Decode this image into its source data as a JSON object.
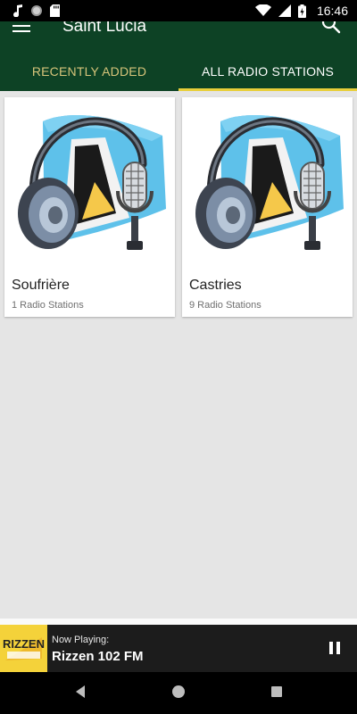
{
  "status_bar": {
    "time": "16:46",
    "left_icons": [
      "music-note-icon",
      "record-icon",
      "sd-card-icon"
    ],
    "right_icons": [
      "wifi-icon",
      "signal-icon",
      "battery-icon"
    ]
  },
  "app_bar": {
    "title": "Saint Lucia",
    "menu_icon": "hamburger-icon",
    "search_icon": "search-icon",
    "background_color": "#0d4225"
  },
  "tabs": [
    {
      "label": "RECENTLY ADDED",
      "active": false,
      "color": "#d6c47a"
    },
    {
      "label": "ALL RADIO STATIONS",
      "active": true,
      "color": "#ffffff"
    }
  ],
  "tab_indicator_color": "#e8cf3a",
  "cards": [
    {
      "title": "Soufrière",
      "subtitle": "1 Radio Stations",
      "image": "headphones-microphone-flag-icon"
    },
    {
      "title": "Castries",
      "subtitle": "9 Radio Stations",
      "image": "headphones-microphone-flag-icon"
    }
  ],
  "now_playing": {
    "label": "Now Playing:",
    "station": "Rizzen 102 FM",
    "logo_text": "RIZZEN",
    "pause_icon": "pause-icon"
  },
  "nav_bar": {
    "icons": [
      "back-icon",
      "home-icon",
      "recents-icon"
    ]
  }
}
